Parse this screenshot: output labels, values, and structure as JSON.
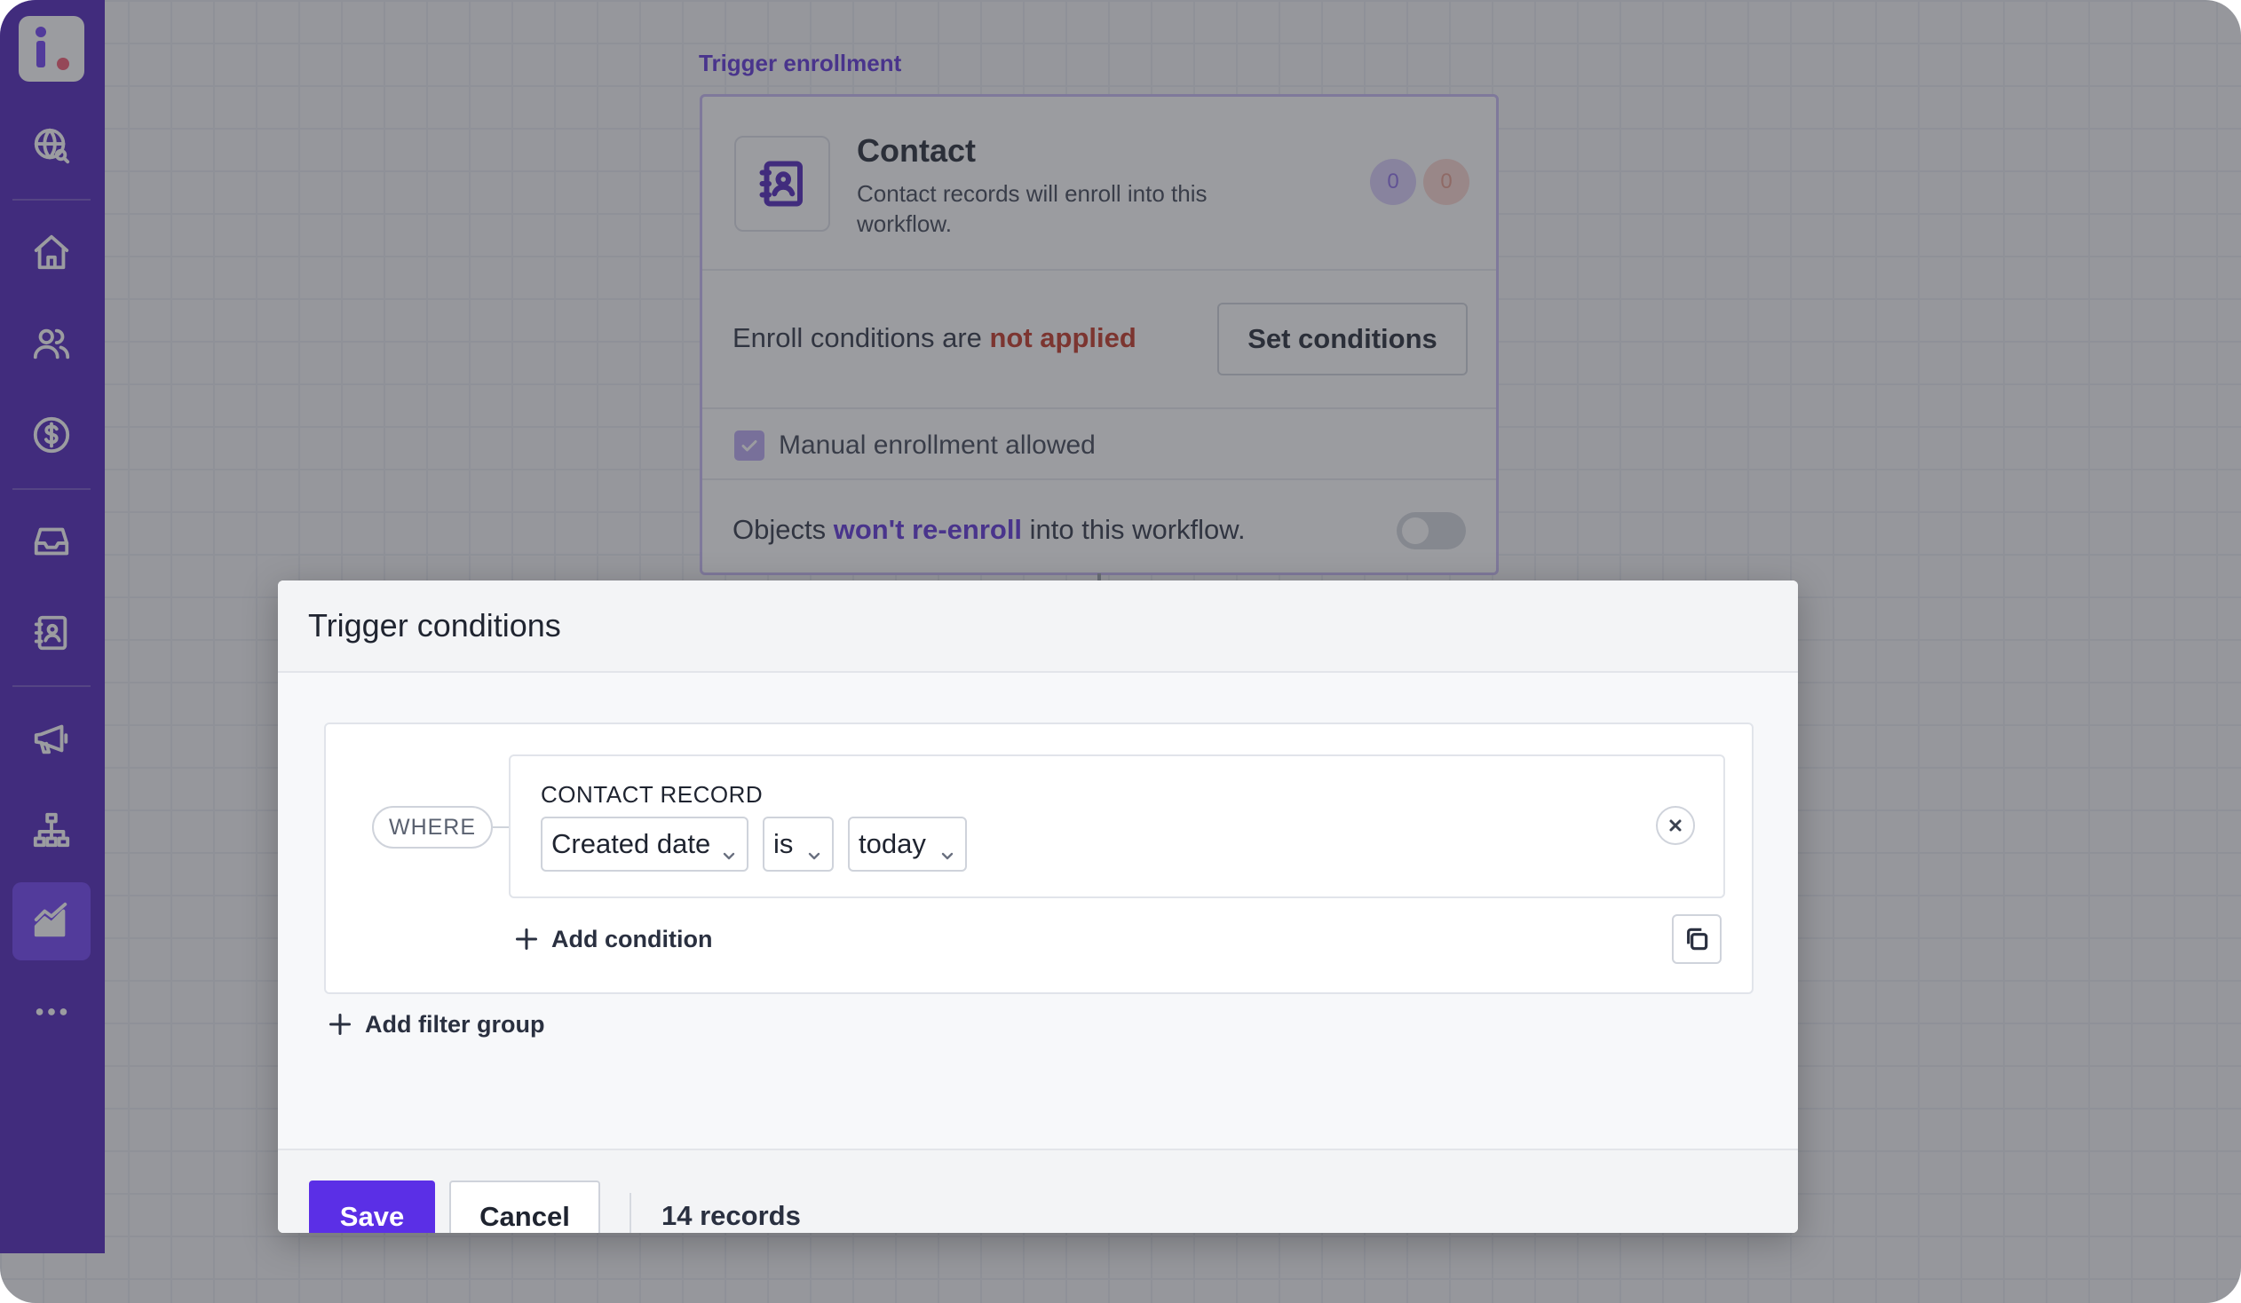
{
  "sidebar": {
    "logo_name": "app-logo",
    "items": [
      {
        "name": "globe-search-icon",
        "active": false
      },
      {
        "name": "home-icon",
        "active": false
      },
      {
        "name": "users-icon",
        "active": false
      },
      {
        "name": "dollar-icon",
        "active": false
      },
      {
        "name": "inbox-icon",
        "active": false
      },
      {
        "name": "contact-book-icon",
        "active": false
      },
      {
        "name": "megaphone-icon",
        "active": false
      },
      {
        "name": "hierarchy-icon",
        "active": false
      },
      {
        "name": "chart-icon",
        "active": true
      },
      {
        "name": "more-icon",
        "active": false
      }
    ]
  },
  "workflow": {
    "section_label": "Trigger enrollment",
    "object_title": "Contact",
    "object_desc": "Contact records will enroll into this workflow.",
    "badge_enrolled": "0",
    "badge_failed": "0",
    "enroll_prefix": "Enroll conditions are ",
    "enroll_status": "not applied",
    "set_conditions_label": "Set conditions",
    "manual_label": "Manual enrollment allowed",
    "reenroll_prefix": "Objects ",
    "reenroll_status": "won't re-enroll",
    "reenroll_suffix": " into this workflow."
  },
  "modal": {
    "title": "Trigger conditions",
    "where_label": "WHERE",
    "condition": {
      "object_label": "CONTACT RECORD",
      "field": "Created date",
      "operator": "is",
      "value": "today"
    },
    "add_condition_label": "Add condition",
    "add_filter_group_label": "Add filter group",
    "save_label": "Save",
    "cancel_label": "Cancel",
    "records_count": "14 records"
  },
  "colors": {
    "sidebar_bg": "#4b1fb8",
    "accent": "#5b2fe6",
    "danger_text": "#c0311f"
  }
}
